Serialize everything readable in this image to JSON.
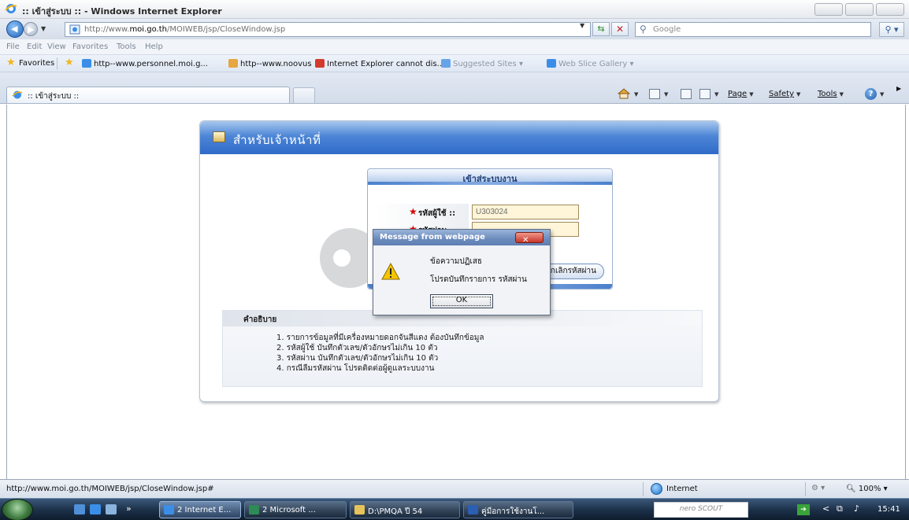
{
  "window": {
    "title": ":: เข้าสู่ระบบ :: - Windows Internet Explorer"
  },
  "address_bar": {
    "url_prefix": "http://www.",
    "url_host": "moi.go.th",
    "url_path": "/MOIWEB/jsp/CloseWindow.jsp"
  },
  "search": {
    "placeholder": "Google"
  },
  "menu": {
    "items": [
      "File",
      "Edit",
      "View",
      "Favorites",
      "Tools",
      "Help"
    ]
  },
  "favorites_bar": {
    "favorites_label": "Favorites",
    "links": [
      "http--www.personnel.moi.g...",
      "http--www.noovus",
      "Internet Explorer cannot dis...",
      "Suggested Sites",
      "Web Slice Gallery"
    ]
  },
  "tabs": {
    "active_label": ":: เข้าสู่ระบบ ::"
  },
  "command_bar": {
    "page": "Page",
    "safety": "Safety",
    "tools": "Tools"
  },
  "panel": {
    "header_title": "สำหรับเจ้าหน้าที่",
    "login_title": "เข้าสู่ระบบงาน",
    "username_label": "รหัสผู้ใช้ ::",
    "username_value": "U303024",
    "password_label": "รหัสผ่าน",
    "password_value": "",
    "reset_button": "ยกเลิกรหัสผ่าน",
    "desc_title": "คำอธิบาย",
    "desc_items": [
      "1. รายการข้อมูลที่มีเครื่องหมายดอกจันสีแดง ต้องบันทึกข้อมูล",
      "2. รหัสผู้ใช้ บันทึกตัวเลข/ตัวอักษรไม่เกิน 10 ตัว",
      "3. รหัสผ่าน บันทึกตัวเลข/ตัวอักษรไม่เกิน 10 ตัว",
      "4. กรณีลืมรหัสผ่าน โปรดติดต่อผู้ดูแลระบบงาน"
    ]
  },
  "dialog": {
    "title": "Message from webpage",
    "line1": "ข้อความปฏิเสธ",
    "line2": "โปรดบันทึกรายการ รหัสผ่าน",
    "ok_label": "OK"
  },
  "status_bar": {
    "url": "http://www.moi.go.th/MOIWEB/jsp/CloseWindow.jsp#",
    "zone": "Internet",
    "zoom": "100%"
  },
  "taskbar": {
    "buttons": [
      "2 Internet E...",
      "2 Microsoft ...",
      "D:\\PMQA ปี 54",
      "คู่มือการใช้งานโ..."
    ],
    "nero_label": "nero SCOUT",
    "clock": "15:41"
  }
}
